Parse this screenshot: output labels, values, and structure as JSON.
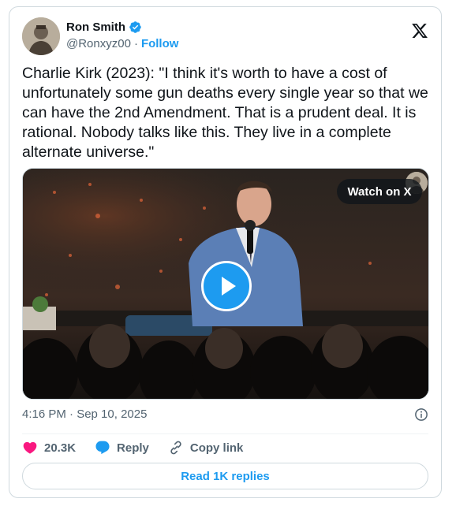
{
  "tweet": {
    "author": {
      "name": "Ron Smith",
      "handle": "@Ronxyz00",
      "separator": "·",
      "follow_label": "Follow",
      "verified": true
    },
    "text": "Charlie Kirk (2023): \"I think it's worth to have a cost of unfortunately some gun deaths every single year so that we can have the 2nd Amendment. That is a prudent deal. It is rational. Nobody talks like this. They live in a complete alternate universe.\"",
    "media": {
      "watch_label": "Watch on X"
    },
    "timestamp": "4:16 PM · Sep 10, 2025",
    "actions": {
      "likes_count": "20.3K",
      "reply_label": "Reply",
      "copy_link_label": "Copy link"
    },
    "read_replies_label": "Read 1K replies"
  },
  "colors": {
    "accent": "#1d9bf0",
    "like": "#f91880",
    "secondary_text": "#536471",
    "border": "#cfd9de"
  },
  "icons": [
    "verified-badge-icon",
    "x-logo-icon",
    "play-icon",
    "info-icon",
    "heart-icon",
    "reply-bubble-icon",
    "link-icon"
  ]
}
